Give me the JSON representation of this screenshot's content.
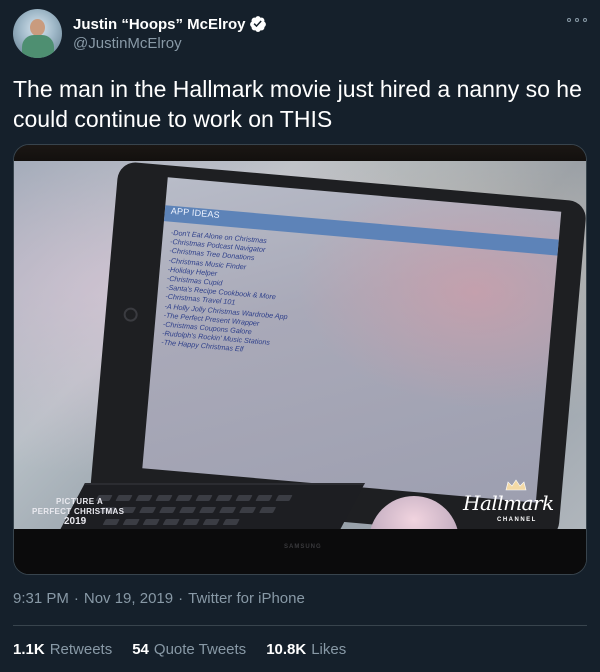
{
  "user": {
    "display_name": "Justin “Hoops” McElroy",
    "handle": "@JustinMcElroy",
    "verified": true
  },
  "tweet": {
    "text": "The man in the Hallmark movie just hired a nanny so he could continue to work on THIS"
  },
  "media": {
    "doc_title": "APP IDEAS",
    "app_ideas": [
      "-Don't Eat Alone on Christmas",
      "-Christmas Podcast Navigator",
      "-Christmas Tree Donations",
      "-Christmas Music Finder",
      "-Holiday Helper",
      "-Christmas Cupid",
      "-Santa's Recipe Cookbook & More",
      "-Christmas Travel 101",
      "-A Holly Jolly Christmas Wardrobe App",
      "-The Perfect Present Wrapper",
      "-Christmas Coupons Galore",
      "-Rudolph's Rockin' Music Stations",
      "-The Happy Christmas Elf"
    ],
    "promo_line1": "PICTURE A",
    "promo_line2": "PERFECT CHRISTMAS",
    "promo_line3": "2019",
    "channel_logo": "Hallmark",
    "channel_sub": "CHANNEL",
    "tv_brand": "SAMSUNG"
  },
  "meta": {
    "time": "9:31 PM",
    "date": "Nov 19, 2019",
    "source": "Twitter for iPhone",
    "separator": "·"
  },
  "stats": {
    "retweets_count": "1.1K",
    "retweets_label": "Retweets",
    "quotes_count": "54",
    "quotes_label": "Quote Tweets",
    "likes_count": "10.8K",
    "likes_label": "Likes"
  },
  "colors": {
    "background": "#15202b",
    "text_primary": "#ffffff",
    "text_secondary": "#8899a6",
    "divider": "#38444d",
    "verified_badge": "#ffffff"
  }
}
